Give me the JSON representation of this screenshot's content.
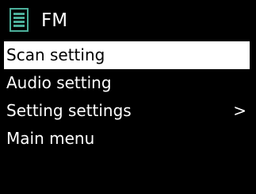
{
  "header": {
    "icon": "radio-list-icon",
    "title": "FM"
  },
  "menu": {
    "items": [
      {
        "label": "Scan setting",
        "selected": true,
        "arrow": ""
      },
      {
        "label": "Audio setting",
        "selected": false,
        "arrow": ""
      },
      {
        "label": "Setting settings",
        "selected": false,
        "arrow": ">"
      },
      {
        "label": "Main menu",
        "selected": false,
        "arrow": ""
      }
    ]
  },
  "colors": {
    "background": "#000000",
    "text": "#ffffff",
    "selection_bg": "#ffffff",
    "selection_text": "#000000",
    "icon": "#4caf9a"
  }
}
